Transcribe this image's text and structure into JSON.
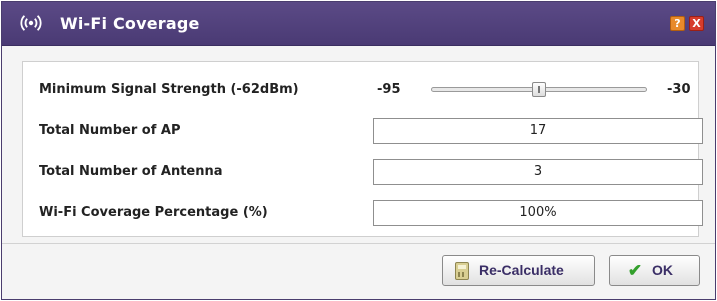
{
  "window": {
    "title": "Wi-Fi Coverage",
    "icon": "wifi-signal-icon",
    "help_icon": "help-icon",
    "close_icon": "close-icon",
    "help_glyph": "?",
    "close_glyph": "X"
  },
  "signal": {
    "label": "Minimum Signal Strength (-62dBm)",
    "min_label": "-95",
    "max_label": "-30",
    "value_dbm": -62
  },
  "fields": {
    "ap_label": "Total Number of AP",
    "ap_value": "17",
    "antenna_label": "Total Number of Antenna",
    "antenna_value": "3",
    "coverage_label": "Wi-Fi Coverage Percentage (%)",
    "coverage_value": "100%"
  },
  "buttons": {
    "recalc_label": "Re-Calculate",
    "recalc_icon": "calculator-icon",
    "ok_label": "OK",
    "ok_icon": "check-icon",
    "ok_glyph": "✔"
  },
  "colors": {
    "titlebar": "#4f3f7a",
    "button_text": "#3a2e66",
    "ok_check": "#33a02c"
  }
}
